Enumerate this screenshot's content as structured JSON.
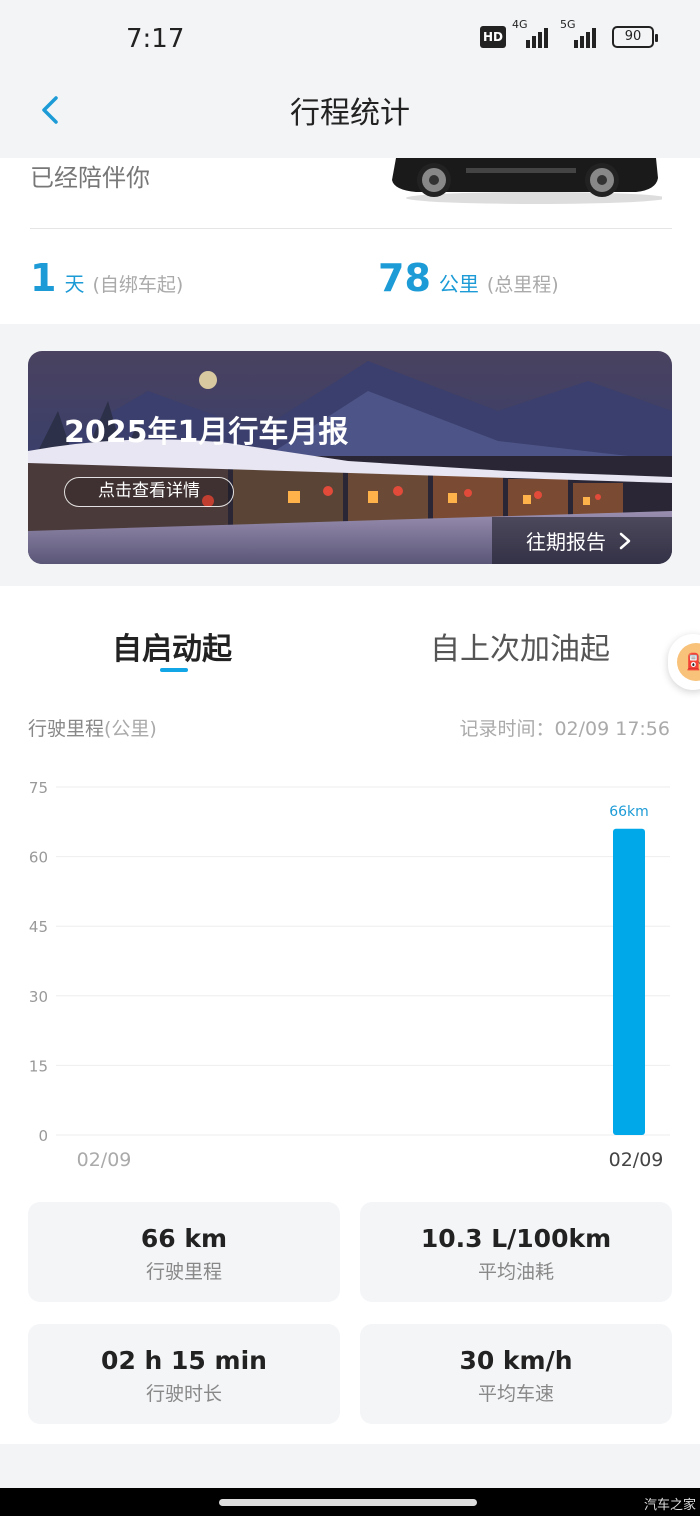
{
  "status_bar": {
    "time": "7:17",
    "hd": "HD",
    "net1": "4G",
    "net2": "5G",
    "battery": "90"
  },
  "nav": {
    "title": "行程统计"
  },
  "summary": {
    "companion_text": "已经陪伴你",
    "days_value": "1",
    "days_unit": "天",
    "days_note": "(自绑车起)",
    "km_value": "78",
    "km_unit": "公里",
    "km_note": "(总里程)"
  },
  "banner": {
    "title": "2025年1月行车月报",
    "detail_button": "点击查看详情",
    "history_link": "往期报告"
  },
  "tabs": [
    {
      "label": "自启动起",
      "active": true
    },
    {
      "label": "自上次加油起",
      "active": false
    }
  ],
  "side_button_icon": "refuel-icon",
  "chart_header": {
    "label": "行驶里程",
    "unit": "(公里)",
    "record_time": "记录时间：02/09 17:56"
  },
  "chart_data": {
    "type": "bar",
    "categories": [
      "02/09"
    ],
    "values": [
      66
    ],
    "value_labels": [
      "66km"
    ],
    "x_tick_labels": [
      "02/09",
      "02/09"
    ],
    "ylim": [
      0,
      75
    ],
    "y_ticks": [
      "0",
      "15",
      "30",
      "45",
      "60",
      "75"
    ],
    "grid": true,
    "bar_color": "#00a8ea"
  },
  "metrics": [
    {
      "value": "66 km",
      "label": "行驶里程"
    },
    {
      "value": "10.3 L/100km",
      "label": "平均油耗"
    },
    {
      "value": "02 h 15 min",
      "label": "行驶时长"
    },
    {
      "value": "30 km/h",
      "label": "平均车速"
    }
  ],
  "watermark": "汽车之家",
  "colors": {
    "accent": "#1c9bd6",
    "tab_underline": "#12a6e6",
    "bar": "#00a8ea"
  }
}
